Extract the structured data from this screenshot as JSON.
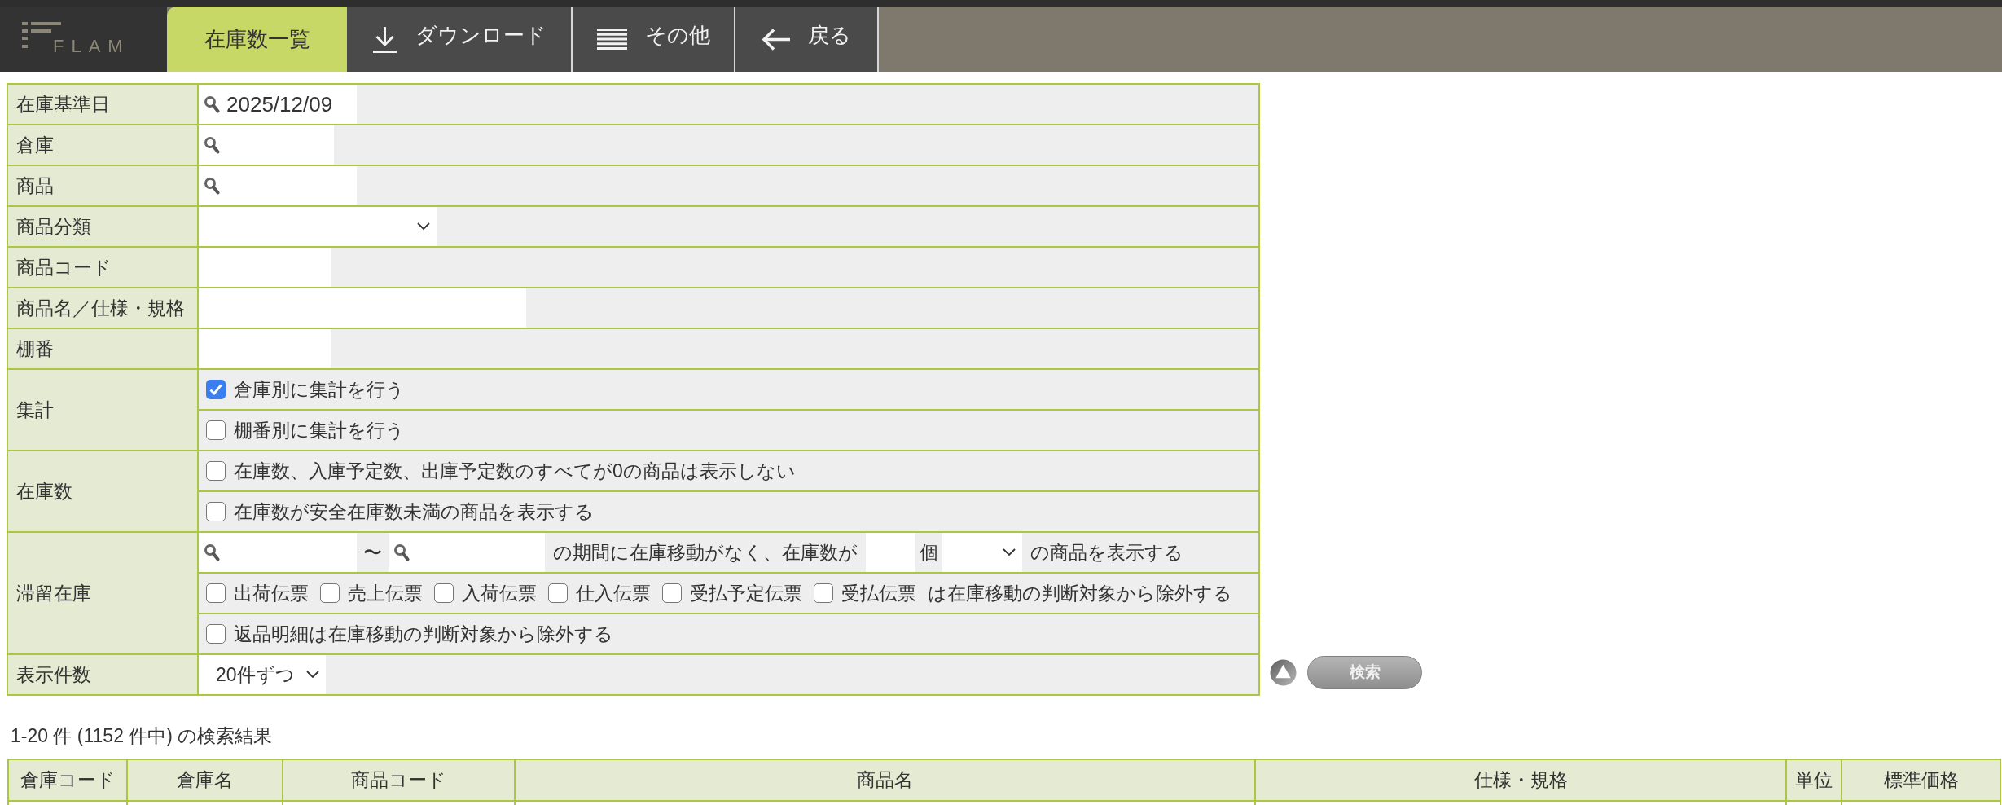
{
  "logo": {
    "text": "FLAM"
  },
  "tabs": [
    {
      "kind": "page",
      "label": "在庫数一覧",
      "selected": true
    },
    {
      "kind": "download",
      "label": "ダウンロード",
      "selected": false
    },
    {
      "kind": "menu",
      "label": "その他",
      "selected": false
    },
    {
      "kind": "back",
      "label": "戻る",
      "selected": false
    }
  ],
  "search_form": {
    "rows": [
      {
        "label": "在庫基準日",
        "lines": [
          {
            "items": [
              {
                "kind": "lookup",
                "value": "2025/12/09"
              }
            ]
          }
        ]
      },
      {
        "label": "倉庫",
        "lines": [
          {
            "items": [
              {
                "kind": "lookup"
              }
            ]
          }
        ]
      },
      {
        "label": "商品",
        "lines": [
          {
            "items": [
              {
                "kind": "lookup"
              }
            ]
          }
        ]
      },
      {
        "label": "商品分類",
        "lines": [
          {
            "items": [
              {
                "kind": "select"
              }
            ]
          }
        ]
      },
      {
        "label": "商品コード",
        "lines": [
          {
            "items": [
              {
                "kind": "text"
              }
            ]
          }
        ]
      },
      {
        "label": "商品名／仕様・規格",
        "lines": [
          {
            "items": [
              {
                "kind": "text"
              }
            ]
          }
        ]
      },
      {
        "label": "棚番",
        "lines": [
          {
            "items": [
              {
                "kind": "text"
              }
            ]
          }
        ]
      },
      {
        "label": "集計",
        "lines": [
          {
            "items": [
              {
                "kind": "checkbox",
                "label": "倉庫別に集計を行う",
                "checked": true
              }
            ]
          },
          {
            "items": [
              {
                "kind": "checkbox",
                "label": "棚番別に集計を行う",
                "checked": false
              }
            ]
          }
        ]
      },
      {
        "label": "在庫数",
        "lines": [
          {
            "items": [
              {
                "kind": "checkbox",
                "label": "在庫数、入庫予定数、出庫予定数のすべてが0の商品は表示しない",
                "checked": false
              }
            ]
          },
          {
            "items": [
              {
                "kind": "checkbox",
                "label": "在庫数が安全在庫数未満の商品を表示する",
                "checked": false
              }
            ]
          }
        ]
      },
      {
        "label": "滞留在庫",
        "lines": [
          {
            "items": [
              {
                "kind": "lookup"
              },
              {
                "kind": "note",
                "text": "〜"
              },
              {
                "kind": "lookup"
              },
              {
                "kind": "note",
                "text": "の期間に在庫移動がなく、在庫数が"
              },
              {
                "kind": "text"
              },
              {
                "kind": "note",
                "text": "個"
              },
              {
                "kind": "select"
              },
              {
                "kind": "note",
                "text": "の商品を表示する"
              }
            ]
          },
          {
            "items": [
              {
                "kind": "checkbox",
                "label": "出荷伝票",
                "checked": false
              },
              {
                "kind": "checkbox",
                "label": "売上伝票",
                "checked": false
              },
              {
                "kind": "checkbox",
                "label": "入荷伝票",
                "checked": false
              },
              {
                "kind": "checkbox",
                "label": "仕入伝票",
                "checked": false
              },
              {
                "kind": "checkbox",
                "label": "受払予定伝票",
                "checked": false
              },
              {
                "kind": "checkbox",
                "label": "受払伝票",
                "checked": false
              },
              {
                "kind": "note",
                "text": "は在庫移動の判断対象から除外する"
              }
            ]
          },
          {
            "items": [
              {
                "kind": "checkbox",
                "label": "返品明細は在庫移動の判断対象から除外する",
                "checked": false
              }
            ]
          }
        ]
      },
      {
        "label": "表示件数",
        "lines": [
          {
            "items": [
              {
                "kind": "select",
                "value": "20件ずつ"
              }
            ]
          }
        ]
      }
    ]
  },
  "search_button": {
    "label": "検索"
  },
  "results": {
    "summary": "1-20 件 (1152 件中) の検索結果",
    "table": {
      "columns": [
        "倉庫コード",
        "倉庫名",
        "商品コード",
        "商品名",
        "仕様・規格",
        "単位",
        "標準価格"
      ]
    }
  }
}
